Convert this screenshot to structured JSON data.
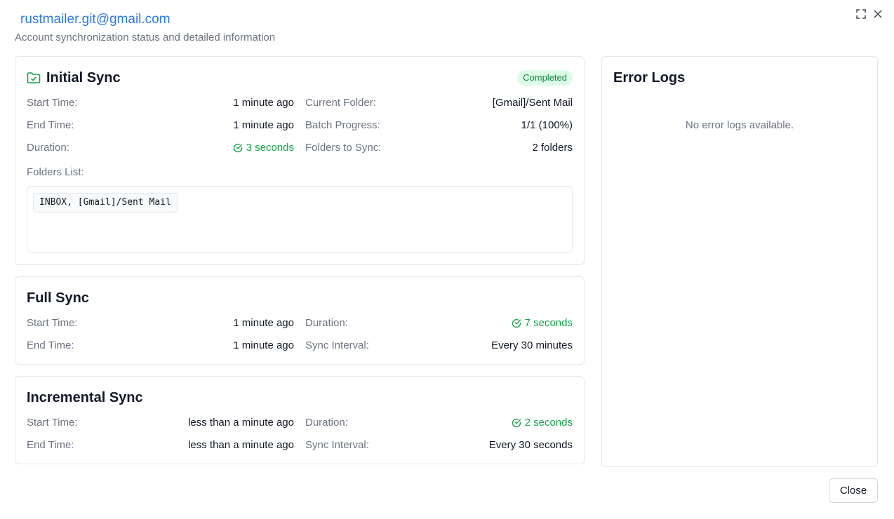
{
  "header": {
    "title": "rustmailer.git@gmail.com",
    "subtitle": "Account synchronization status and detailed information"
  },
  "window_controls": {
    "fullscreen_icon": "fullscreen-icon",
    "close_icon": "close-icon"
  },
  "initial_sync": {
    "title": "Initial Sync",
    "icon": "folder-check-icon",
    "status": "Completed",
    "start_time_label": "Start Time:",
    "start_time": "1 minute ago",
    "end_time_label": "End Time:",
    "end_time": "1 minute ago",
    "duration_label": "Duration:",
    "duration": "3 seconds",
    "current_folder_label": "Current Folder:",
    "current_folder": "[Gmail]/Sent Mail",
    "batch_progress_label": "Batch Progress:",
    "batch_progress": "1/1 (100%)",
    "folders_to_sync_label": "Folders to Sync:",
    "folders_to_sync": "2 folders",
    "folders_list_label": "Folders List:",
    "folders_list": "INBOX, [Gmail]/Sent Mail"
  },
  "full_sync": {
    "title": "Full Sync",
    "start_time_label": "Start Time:",
    "start_time": "1 minute ago",
    "end_time_label": "End Time:",
    "end_time": "1 minute ago",
    "duration_label": "Duration:",
    "duration": "7 seconds",
    "sync_interval_label": "Sync Interval:",
    "sync_interval": "Every 30 minutes"
  },
  "incremental_sync": {
    "title": "Incremental Sync",
    "start_time_label": "Start Time:",
    "start_time": "less than a minute ago",
    "end_time_label": "End Time:",
    "end_time": "less than a minute ago",
    "duration_label": "Duration:",
    "duration": "2 seconds",
    "sync_interval_label": "Sync Interval:",
    "sync_interval": "Every 30 seconds"
  },
  "error_logs": {
    "title": "Error Logs",
    "empty_message": "No error logs available."
  },
  "footer": {
    "close_label": "Close"
  },
  "colors": {
    "accent": "#2a7ae4",
    "success": "#16a34a",
    "badge_bg": "#dcfce7"
  }
}
